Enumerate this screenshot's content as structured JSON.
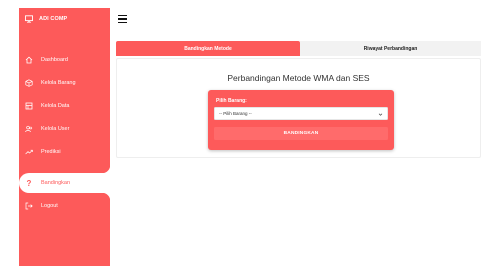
{
  "sidebar": {
    "brand": "ADI COMP",
    "items": [
      {
        "label": "Dashboard",
        "icon": "home-icon"
      },
      {
        "label": "Kelola Barang",
        "icon": "box-icon"
      },
      {
        "label": "Kelola Data",
        "icon": "database-icon"
      },
      {
        "label": "Kelola User",
        "icon": "users-icon"
      },
      {
        "label": "Prediksi",
        "icon": "trend-icon"
      },
      {
        "label": "Bandingkan",
        "icon": "question-icon"
      },
      {
        "label": "Logout",
        "icon": "logout-icon"
      }
    ],
    "active_index": 5
  },
  "tabs": [
    {
      "label": "Bandingkan Metode"
    },
    {
      "label": "Riwayat Perbandingan"
    }
  ],
  "main": {
    "title": "Perbandingan Metode WMA dan SES",
    "form": {
      "label": "Pilih Barang:",
      "select_value": "-- Pilih Barang --",
      "button_label": "BANDINGKAN"
    }
  },
  "colors": {
    "accent": "#fd5a5a",
    "button": "#ff6b6b"
  }
}
